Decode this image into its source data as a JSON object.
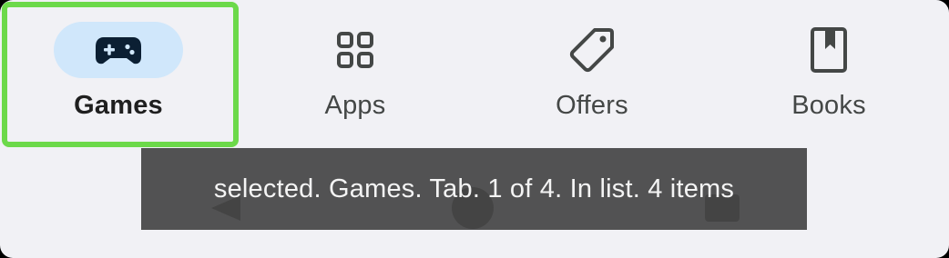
{
  "tabs": [
    {
      "label": "Games",
      "icon": "gamepad-icon",
      "selected": true
    },
    {
      "label": "Apps",
      "icon": "apps-grid-icon",
      "selected": false
    },
    {
      "label": "Offers",
      "icon": "tag-icon",
      "selected": false
    },
    {
      "label": "Books",
      "icon": "book-icon",
      "selected": false
    }
  ],
  "accessibility_toast": {
    "text": "selected. Games. Tab. 1 of 4. In list. 4 items"
  },
  "system_nav": {
    "buttons": [
      "back-icon",
      "home-icon",
      "recents-icon"
    ]
  },
  "colors": {
    "selected_pill": "#d0e7fb",
    "focus_ring": "#6cd94a",
    "icon_selected": "#0b1f33",
    "icon_default": "#444746",
    "background": "#f1f1f5"
  }
}
